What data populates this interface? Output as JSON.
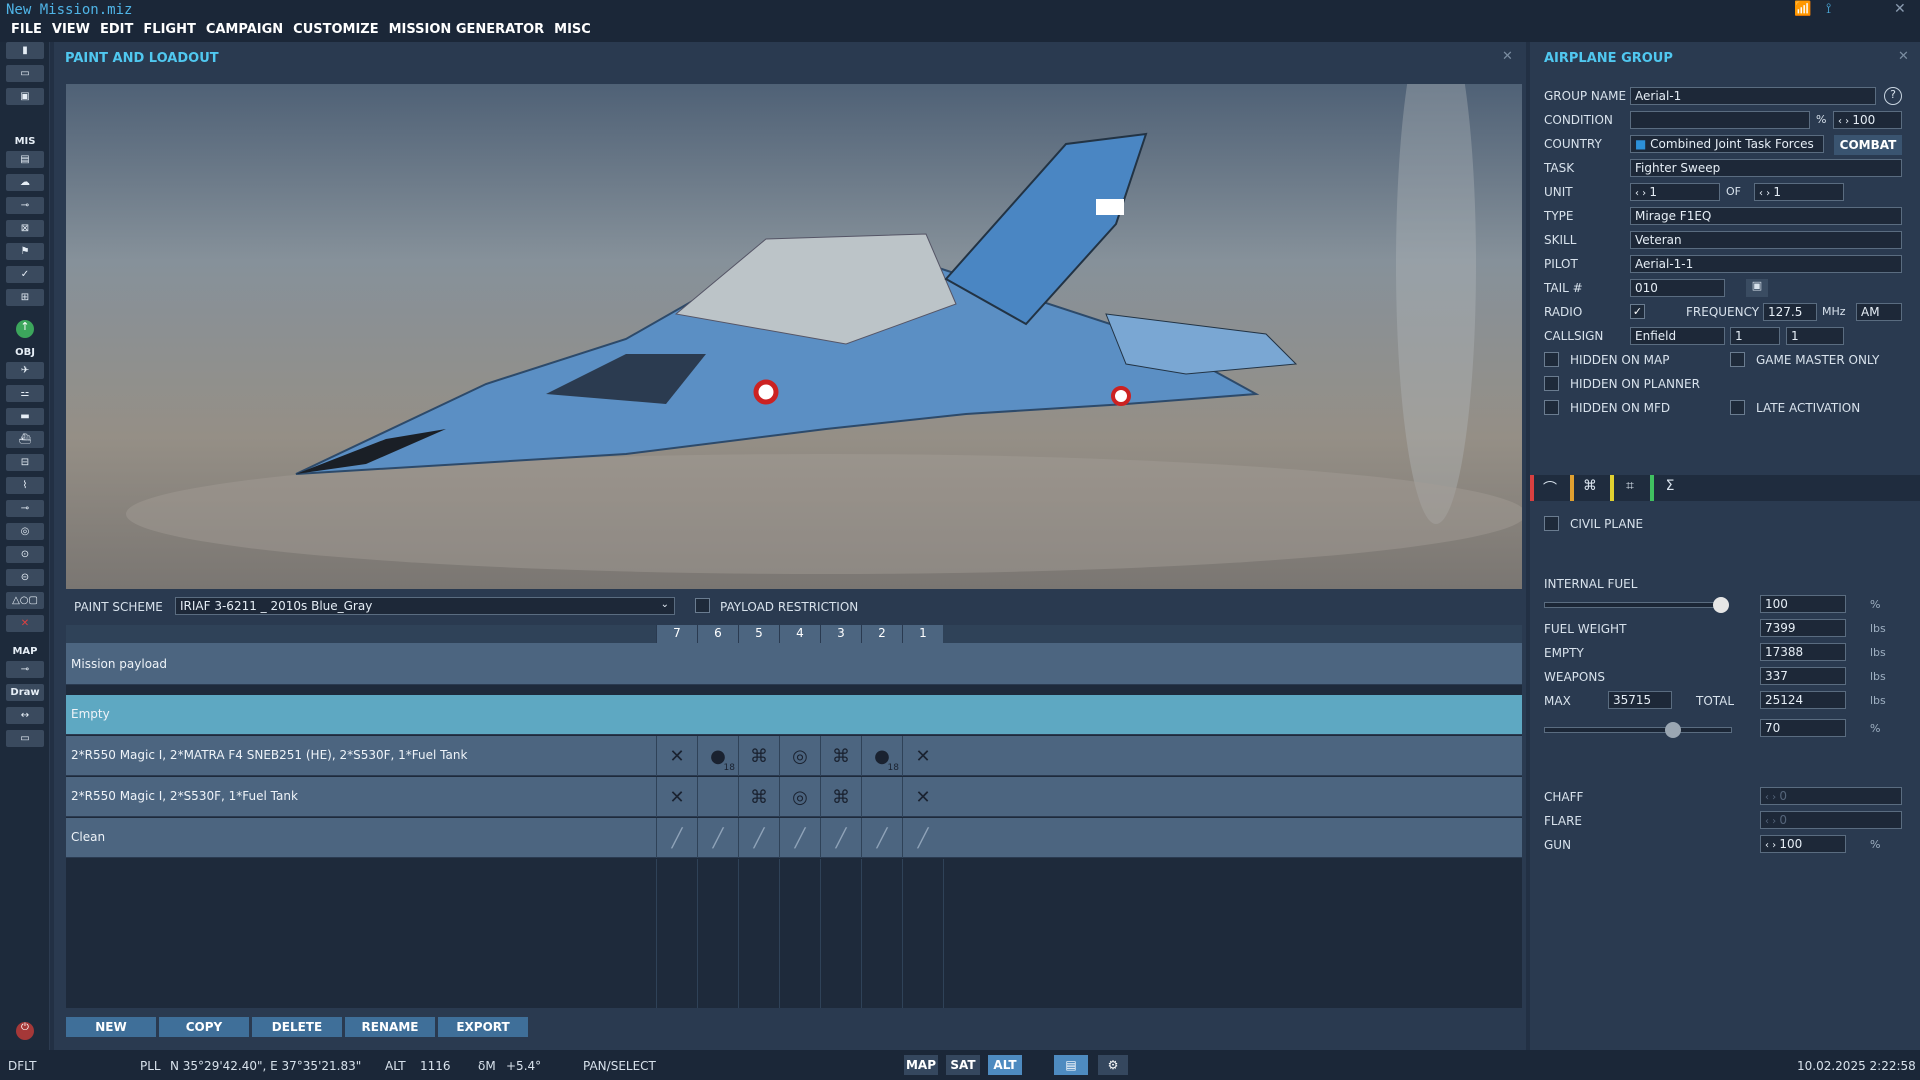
{
  "window": {
    "title": "New Mission.miz"
  },
  "menu": [
    "FILE",
    "VIEW",
    "EDIT",
    "FLIGHT",
    "CAMPAIGN",
    "CUSTOMIZE",
    "MISSION GENERATOR",
    "MISC"
  ],
  "sidebar": {
    "mis_label": "MIS",
    "obj_label": "OBJ",
    "map_label": "MAP",
    "draw_label": "Draw"
  },
  "paint_panel": {
    "title": "PAINT AND LOADOUT",
    "paint_scheme_label": "PAINT SCHEME",
    "paint_scheme_value": "IRIAF 3-6211 _ 2010s Blue_Gray",
    "payload_restriction_label": "PAYLOAD RESTRICTION",
    "slot_headers": [
      "7",
      "6",
      "5",
      "4",
      "3",
      "2",
      "1"
    ],
    "mission_payload_label": "Mission payload",
    "loadouts": [
      {
        "name": "Empty",
        "slots": [
          "",
          "",
          "",
          "",
          "",
          "",
          ""
        ]
      },
      {
        "name": "2*R550 Magic I, 2*MATRA F4 SNEB251 (HE), 2*S530F, 1*Fuel Tank",
        "slots": [
          "✕",
          "●",
          "⌘",
          "◎",
          "⌘",
          "●",
          "✕"
        ],
        "counts": [
          "",
          "18",
          "",
          "",
          "",
          "18",
          ""
        ]
      },
      {
        "name": "2*R550 Magic I, 2*S530F, 1*Fuel Tank",
        "slots": [
          "✕",
          "",
          "⌘",
          "◎",
          "⌘",
          "",
          "✕"
        ]
      },
      {
        "name": "Clean",
        "slots": [
          "╱",
          "╱",
          "╱",
          "╱",
          "╱",
          "╱",
          "╱"
        ]
      }
    ],
    "buttons": {
      "new": "NEW",
      "copy": "COPY",
      "delete": "DELETE",
      "rename": "RENAME",
      "export": "EXPORT"
    }
  },
  "airplane_group": {
    "title": "AIRPLANE GROUP",
    "group_name_label": "GROUP NAME",
    "group_name": "Aerial-1",
    "condition_label": "CONDITION",
    "condition_unit": "%",
    "condition_value": "100",
    "country_label": "COUNTRY",
    "country": "Combined Joint Task Forces",
    "combat_button": "COMBAT",
    "task_label": "TASK",
    "task": "Fighter Sweep",
    "unit_label": "UNIT",
    "unit": "1",
    "of_label": "OF",
    "unit_total": "1",
    "type_label": "TYPE",
    "type": "Mirage F1EQ",
    "skill_label": "SKILL",
    "skill": "Veteran",
    "pilot_label": "PILOT",
    "pilot": "Aerial-1-1",
    "tail_label": "TAIL #",
    "tail": "010",
    "radio_label": "RADIO",
    "frequency_label": "FREQUENCY",
    "frequency": "127.5",
    "mhz": "MHz",
    "modulation": "AM",
    "callsign_label": "CALLSIGN",
    "callsign": "Enfield",
    "callsign_1": "1",
    "callsign_2": "1",
    "hidden_on_map": "HIDDEN ON MAP",
    "game_master_only": "GAME MASTER ONLY",
    "hidden_on_planner": "HIDDEN ON PLANNER",
    "hidden_on_mfd": "HIDDEN ON MFD",
    "late_activation": "LATE ACTIVATION",
    "civil_plane": "CIVIL PLANE",
    "internal_fuel_label": "INTERNAL FUEL",
    "internal_fuel": "100",
    "pct": "%",
    "fuel_weight_label": "FUEL WEIGHT",
    "fuel_weight": "7399",
    "empty_label": "EMPTY",
    "empty": "17388",
    "weapons_label": "WEAPONS",
    "weapons": "337",
    "max_label": "MAX",
    "max": "35715",
    "total_label": "TOTAL",
    "total": "25124",
    "lbs": "lbs",
    "weight_pct": "70",
    "internal_fuel_fraction": 0.98,
    "weight_fraction": 0.68,
    "chaff_label": "CHAFF",
    "chaff": "0",
    "flare_label": "FLARE",
    "flare": "0",
    "gun_label": "GUN",
    "gun": "100"
  },
  "status": {
    "mode": "DFLT",
    "pll_label": "PLL",
    "coords": "N 35°29'42.40\", E 37°35'21.83\"",
    "alt_label": "ALT",
    "alt": "1116",
    "dm_label": "δM",
    "dm": "+5.4°",
    "tool": "PAN/SELECT",
    "map_btn": "MAP",
    "sat_btn": "SAT",
    "alt_btn": "ALT",
    "datetime": "10.02.2025 2:22:58"
  },
  "colors": {
    "accent": "#50c8f0",
    "selected_row": "#5ea8c2",
    "button": "#3f6f99"
  }
}
